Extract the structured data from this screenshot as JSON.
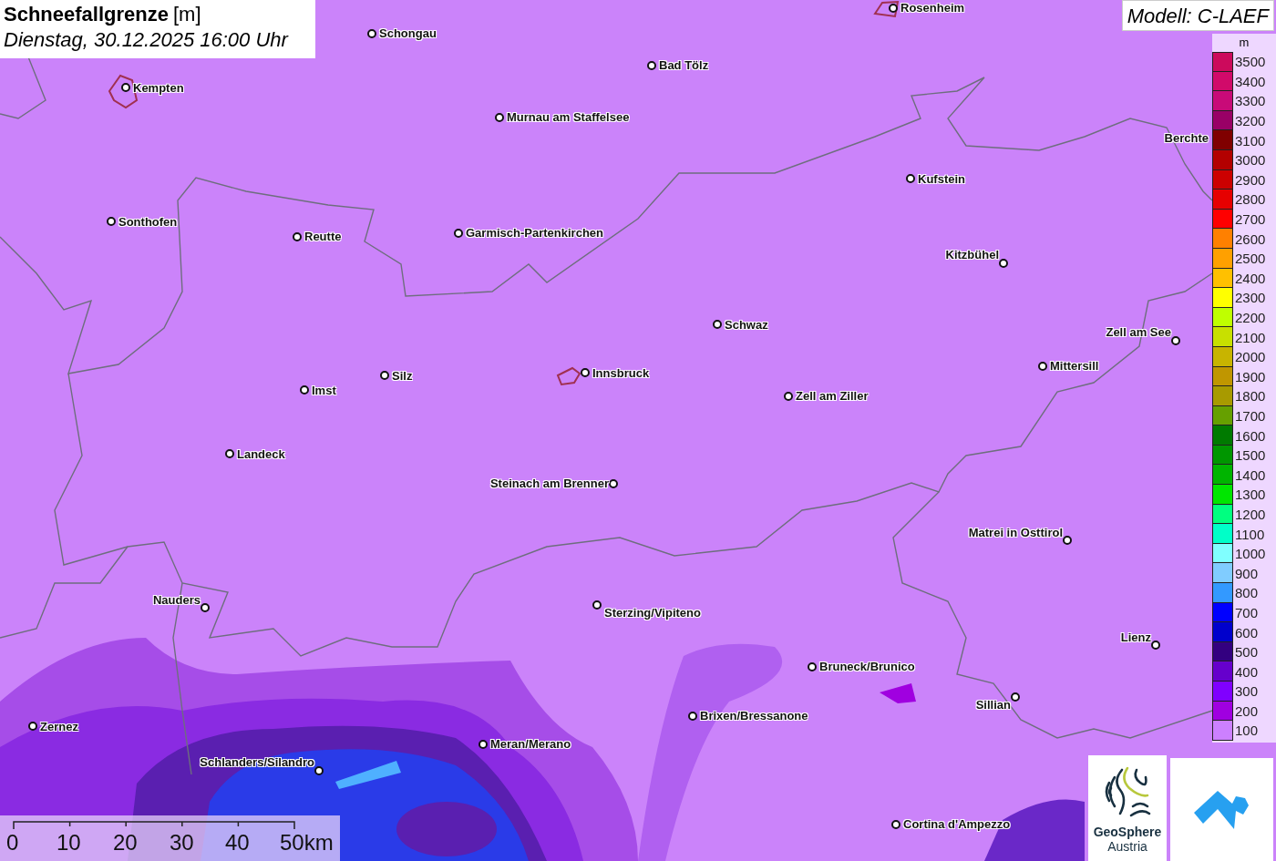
{
  "header": {
    "title": "Schneefallgrenze",
    "unit": "[m]",
    "datetime": "Dienstag, 30.12.2025 16:00 Uhr"
  },
  "model": "Modell: C-LAEF",
  "cities": [
    {
      "name": "Rosenheim"
    },
    {
      "name": "Schongau"
    },
    {
      "name": "Kempten"
    },
    {
      "name": "Bad Tölz"
    },
    {
      "name": "Murnau am Staffelsee"
    },
    {
      "name": "Berchte"
    },
    {
      "name": "Kufstein"
    },
    {
      "name": "Sonthofen"
    },
    {
      "name": "Reutte"
    },
    {
      "name": "Garmisch-Partenkirchen"
    },
    {
      "name": "Kitzbühel"
    },
    {
      "name": "Schwaz"
    },
    {
      "name": "Zell am See"
    },
    {
      "name": "Mittersill"
    },
    {
      "name": "Silz"
    },
    {
      "name": "Innsbruck"
    },
    {
      "name": "Imst"
    },
    {
      "name": "Zell am Ziller"
    },
    {
      "name": "Landeck"
    },
    {
      "name": "Steinach am Brenner"
    },
    {
      "name": "Matrei in Osttirol"
    },
    {
      "name": "Nauders"
    },
    {
      "name": "Sterzing/Vipiteno"
    },
    {
      "name": "Lienz"
    },
    {
      "name": "Bruneck/Brunico"
    },
    {
      "name": "Sillian"
    },
    {
      "name": "Brixen/Bressanone"
    },
    {
      "name": "Zernez"
    },
    {
      "name": "Meran/Merano"
    },
    {
      "name": "Schlanders/Silandro"
    },
    {
      "name": "Cortina d'Ampezzo"
    }
  ],
  "legend": {
    "unit": "m",
    "items": [
      {
        "label": "3500",
        "color": "#cc0a5c"
      },
      {
        "label": "3400",
        "color": "#d10a6a"
      },
      {
        "label": "3300",
        "color": "#c80a78"
      },
      {
        "label": "3200",
        "color": "#990066"
      },
      {
        "label": "3100",
        "color": "#800000"
      },
      {
        "label": "3000",
        "color": "#b30000"
      },
      {
        "label": "2900",
        "color": "#cc0000"
      },
      {
        "label": "2800",
        "color": "#e60000"
      },
      {
        "label": "2700",
        "color": "#ff0000"
      },
      {
        "label": "2600",
        "color": "#ff8000"
      },
      {
        "label": "2500",
        "color": "#ffa000"
      },
      {
        "label": "2400",
        "color": "#ffc000"
      },
      {
        "label": "2300",
        "color": "#ffff00"
      },
      {
        "label": "2200",
        "color": "#bfff00"
      },
      {
        "label": "2100",
        "color": "#c8e000"
      },
      {
        "label": "2000",
        "color": "#c8b400"
      },
      {
        "label": "1900",
        "color": "#c09600"
      },
      {
        "label": "1800",
        "color": "#a89a00"
      },
      {
        "label": "1700",
        "color": "#66a000"
      },
      {
        "label": "1600",
        "color": "#007a00"
      },
      {
        "label": "1500",
        "color": "#009600"
      },
      {
        "label": "1400",
        "color": "#00b400"
      },
      {
        "label": "1300",
        "color": "#00e600"
      },
      {
        "label": "1200",
        "color": "#00ff80"
      },
      {
        "label": "1100",
        "color": "#00ffc8"
      },
      {
        "label": "1000",
        "color": "#80ffff"
      },
      {
        "label": "900",
        "color": "#80ccff"
      },
      {
        "label": "800",
        "color": "#3399ff"
      },
      {
        "label": "700",
        "color": "#0000ff"
      },
      {
        "label": "600",
        "color": "#0000cc"
      },
      {
        "label": "500",
        "color": "#330080"
      },
      {
        "label": "400",
        "color": "#6600cc"
      },
      {
        "label": "300",
        "color": "#8000ff"
      },
      {
        "label": "200",
        "color": "#a000e0"
      },
      {
        "label": "100",
        "color": "#cc80ff"
      }
    ]
  },
  "scale_bar": {
    "labels": [
      "0",
      "10",
      "20",
      "30",
      "40",
      "50km"
    ]
  },
  "logo": {
    "lines": [
      "GeoSphere",
      "Austria"
    ]
  }
}
